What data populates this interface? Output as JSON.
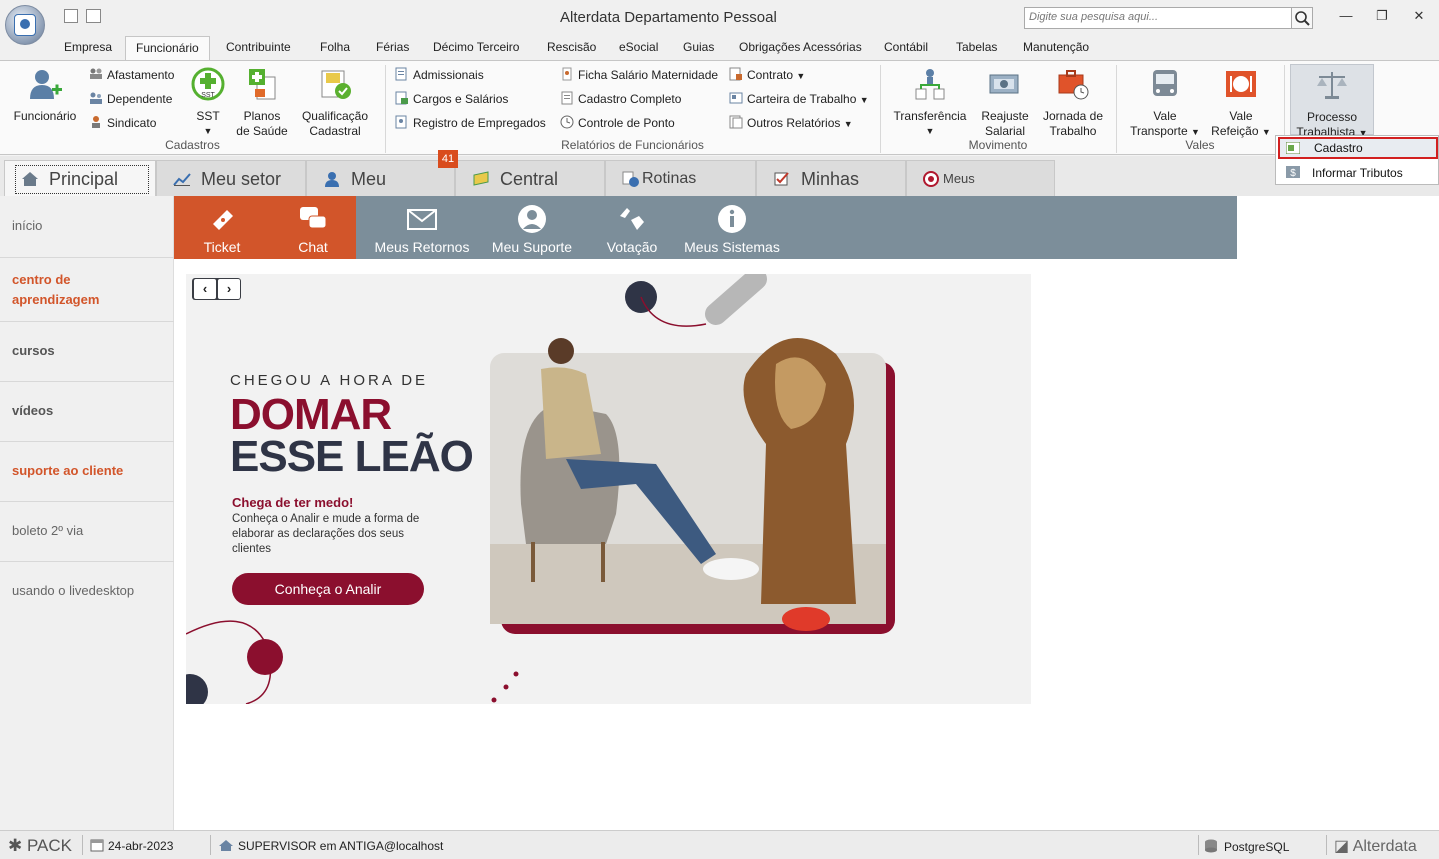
{
  "window": {
    "title": "Alterdata Departamento Pessoal",
    "search_placeholder": "Digite sua pesquisa aqui..."
  },
  "menu": {
    "tabs": [
      "Empresa",
      "Funcionário",
      "Contribuinte",
      "Folha",
      "Férias",
      "Décimo Terceiro",
      "Rescisão",
      "eSocial",
      "Guias",
      "Obrigações Acessórias",
      "Contábil",
      "Tabelas",
      "Manutenção"
    ],
    "active": "Funcionário"
  },
  "ribbon": {
    "cadastros": {
      "label": "Cadastros",
      "funcionario": "Funcionário",
      "afastamento": "Afastamento",
      "dependente": "Dependente",
      "sindicato": "Sindicato",
      "sst_icon_text": "SST",
      "sst": "SST",
      "planos_1": "Planos",
      "planos_2": "de Saúde",
      "qualif_1": "Qualificação",
      "qualif_2": "Cadastral"
    },
    "relatorios": {
      "label": "Relatórios de Funcionários",
      "admissionais": "Admissionais",
      "cargos": "Cargos e Salários",
      "registro": "Registro de Empregados",
      "ficha": "Ficha Salário Maternidade",
      "cadastro_completo": "Cadastro Completo",
      "controle": "Controle de Ponto",
      "contrato": "Contrato",
      "carteira": "Carteira de Trabalho",
      "outros": "Outros Relatórios"
    },
    "movimento": {
      "label": "Movimento",
      "transferencia": "Transferência",
      "reajuste_1": "Reajuste",
      "reajuste_2": "Salarial",
      "jornada_1": "Jornada de",
      "jornada_2": "Trabalho"
    },
    "vales": {
      "label": "Vales",
      "vt_1": "Vale",
      "vt_2": "Transporte",
      "vr_1": "Vale",
      "vr_2": "Refeição"
    },
    "processo": {
      "line1": "Processo",
      "line2": "Trabalhista"
    }
  },
  "dropdown": {
    "items": [
      "Cadastro",
      "Informar Tributos"
    ]
  },
  "page_tabs": {
    "principal": "Principal",
    "meu_setor": "Meu setor",
    "meu_gerente": "Meu Gerente",
    "badge": "41",
    "central_esocial": "Central eSocial",
    "rotinas": "Rotinas automáticas",
    "minhas_tarefas": "Minhas tarefas",
    "meus_atendimentos": "Meus Atendimentos"
  },
  "sidebar": {
    "inicio": "início",
    "centro_1": "centro de",
    "centro_2": "aprendizagem",
    "cursos": "cursos",
    "videos": "vídeos",
    "suporte": "suporte ao cliente",
    "boleto": "boleto 2º via",
    "livedesktop": "usando o livedesktop"
  },
  "top_nav": {
    "ticket": "Ticket",
    "chat": "Chat",
    "retornos": "Meus Retornos",
    "suporte": "Meu Suporte",
    "votacao": "Votação",
    "sistemas": "Meus Sistemas"
  },
  "banner": {
    "kicker": "CHEGOU A HORA DE",
    "headline_1": "DOMAR",
    "headline_2": "ESSE LEÃO",
    "subhead": "Chega de ter medo!",
    "body": "Conheça o Analir e mude a forma de elaborar as declarações dos seus clientes",
    "cta": "Conheça o Analir"
  },
  "status": {
    "pack": "PACK",
    "date": "24-abr-2023",
    "user": "SUPERVISOR em ANTIGA@localhost",
    "db": "PostgreSQL",
    "brand": "Alterdata"
  },
  "colors": {
    "accent_orange": "#d2552a",
    "nav_gray": "#7c8e9a",
    "banner_maroon": "#8b0f2e",
    "highlight_red": "#d22020"
  }
}
